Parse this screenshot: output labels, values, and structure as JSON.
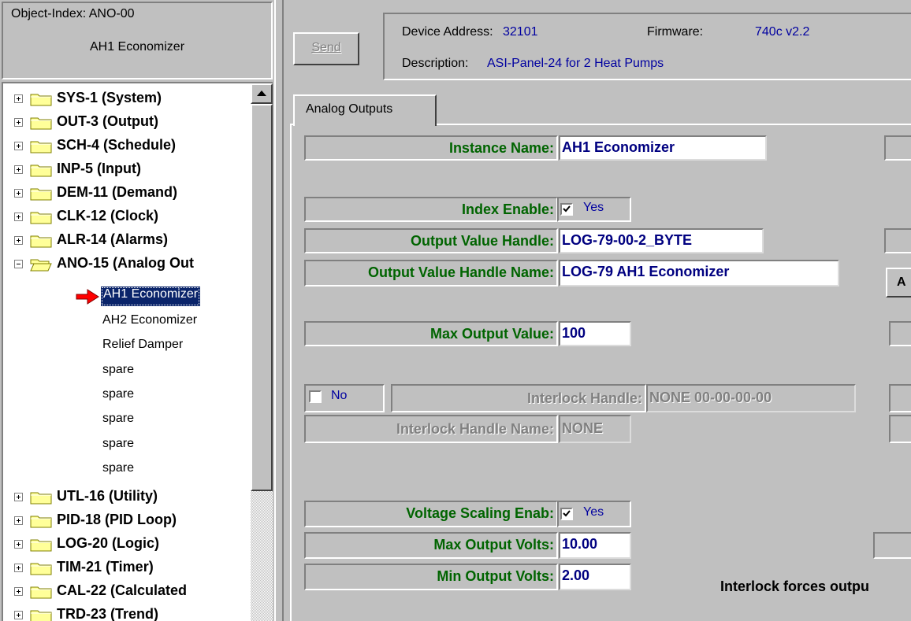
{
  "object_header": {
    "index_label": "Object-Index:",
    "index_value": "ANO-00",
    "name": "AH1 Economizer"
  },
  "tree": {
    "nodes_top": [
      {
        "label": "SYS-1 (System)"
      },
      {
        "label": "OUT-3 (Output)"
      },
      {
        "label": "SCH-4 (Schedule)"
      },
      {
        "label": "INP-5 (Input)"
      },
      {
        "label": "DEM-11 (Demand)"
      },
      {
        "label": "CLK-12 (Clock)"
      },
      {
        "label": "ALR-14 (Alarms)"
      }
    ],
    "expanded_node": {
      "label": "ANO-15 (Analog Out"
    },
    "children": [
      "AH1 Economizer",
      "AH2 Economizer",
      "Relief Damper",
      "spare",
      "spare",
      "spare",
      "spare",
      "spare"
    ],
    "selected_child": "AH1 Economizer",
    "nodes_bottom": [
      {
        "label": "UTL-16 (Utility)"
      },
      {
        "label": "PID-18 (PID Loop)"
      },
      {
        "label": "LOG-20 (Logic)"
      },
      {
        "label": "TIM-21 (Timer)"
      },
      {
        "label": "CAL-22 (Calculated"
      },
      {
        "label": "TRD-23 (Trend)"
      }
    ]
  },
  "toolbar": {
    "send_label": "Send"
  },
  "device": {
    "address_label": "Device Address:",
    "address_value": "32101",
    "firmware_label": "Firmware:",
    "firmware_value": "740c v2.2",
    "description_label": "Description:",
    "description_value": "ASI-Panel-24 for 2 Heat Pumps"
  },
  "tabs": {
    "active": "Analog Outputs"
  },
  "form": {
    "instance_name_label": "Instance Name:",
    "instance_name_value": "AH1 Economizer",
    "index_enable_label": "Index Enable:",
    "index_enable_value": "Yes",
    "output_handle_label": "Output Value Handle:",
    "output_handle_value": "LOG-79-00-2_BYTE",
    "output_handle_name_label": "Output Value Handle Name:",
    "output_handle_name_value": "LOG-79 AH1 Economizer",
    "max_output_label": "Max Output Value:",
    "max_output_value": "100",
    "interlock_toggle_value": "No",
    "interlock_handle_label": "Interlock Handle:",
    "interlock_handle_value": "NONE 00-00-00-00",
    "interlock_handle_name_label": "Interlock Handle Name:",
    "interlock_handle_name_value": "NONE",
    "voltage_scaling_label": "Voltage Scaling Enab:",
    "voltage_scaling_value": "Yes",
    "max_volts_label": "Max Output Volts:",
    "max_volts_value": "10.00",
    "min_volts_label": "Min Output Volts:",
    "min_volts_value": "2.00",
    "interlock_note": "Interlock forces outpu",
    "edge_button_label": "A"
  },
  "colors": {
    "label_green": "#006400",
    "value_navy": "#000080",
    "selection": "#0a246a",
    "folder_yellow": "#ffff99"
  },
  "icons": {
    "tree_folder": "folder-icon",
    "tree_folder_open": "folder-open-icon",
    "selection_arrow": "arrow-right-icon",
    "checkbox": "checkbox-checked-icon"
  }
}
